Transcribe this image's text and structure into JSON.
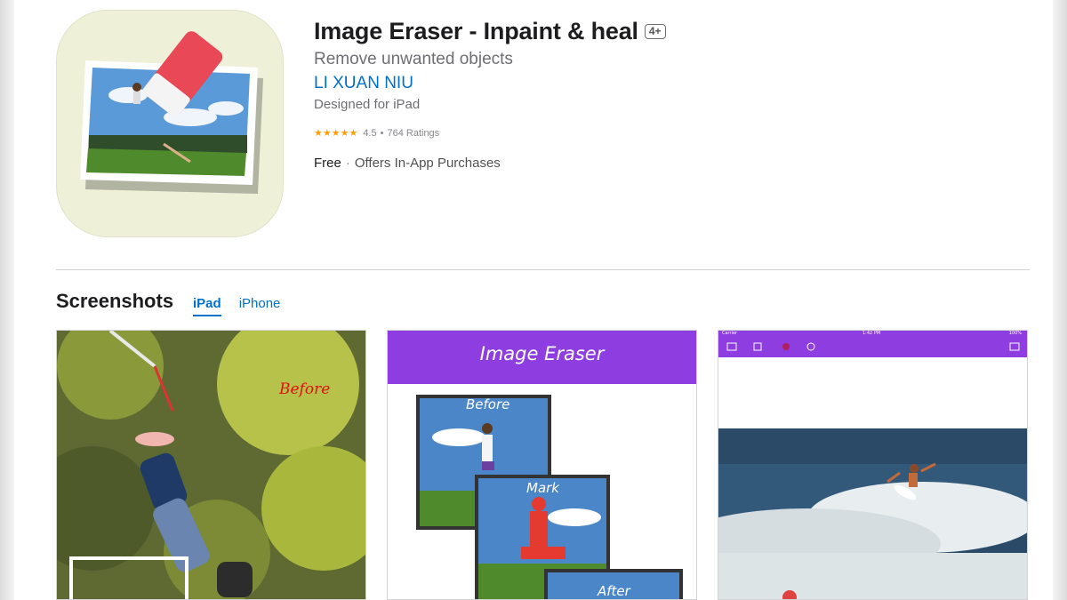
{
  "app": {
    "title": "Image Eraser - Inpaint & heal",
    "age_rating": "4+",
    "subtitle": "Remove unwanted objects",
    "developer": "LI XUAN NIU",
    "designed_for": "Designed for iPad",
    "rating_value": "4.5",
    "rating_count": "764 Ratings",
    "stars": "★★★★★",
    "price": "Free",
    "iap": "Offers In-App Purchases",
    "icon": "eraser-photo-icon"
  },
  "screenshots": {
    "title": "Screenshots",
    "tabs": [
      {
        "label": "iPad",
        "active": true
      },
      {
        "label": "iPhone",
        "active": false
      }
    ],
    "shot1": {
      "overlay": "Before"
    },
    "shot2": {
      "banner": "Image Eraser",
      "labels": [
        "Before",
        "Mark",
        "After"
      ]
    },
    "shot3": {
      "carrier": "Carrier",
      "time": "1:42 PM",
      "battery": "100%"
    }
  },
  "colors": {
    "accent": "#0070c9",
    "purple": "#8e3ee0",
    "star": "#ff9f0a",
    "icon_bg": "#eef0d8"
  }
}
